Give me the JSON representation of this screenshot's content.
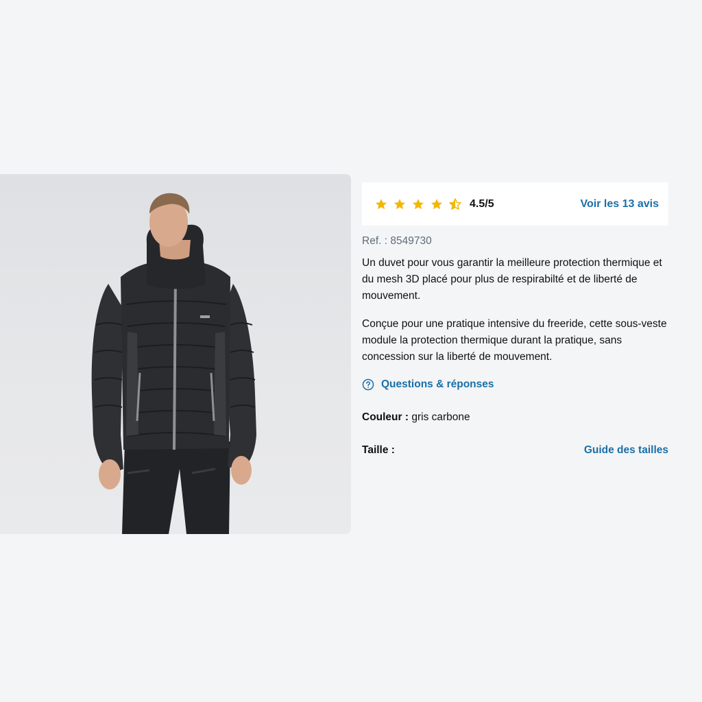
{
  "product": {
    "image_alt": "man wearing a grey down jacket",
    "rating": {
      "stars_filled": 4.5,
      "stars_total": 5,
      "value_text": "4.5/5",
      "reviews_link": "Voir les 13 avis",
      "star_color": "#f2b705"
    },
    "ref": "Ref. : 8549730",
    "description": [
      "Un duvet pour vous garantir la meilleure protection thermique et du mesh 3D placé pour plus de respirabilté et de liberté de mouvement.",
      "Conçue pour une pratique intensive du freeride, cette sous-veste module la protection thermique durant la pratique, sans concession sur la liberté de mouvement."
    ],
    "qa_link": "Questions & réponses",
    "color": {
      "label": "Couleur :",
      "value": "gris carbone"
    },
    "size": {
      "label": "Taille :",
      "guide_link": "Guide des tailles"
    },
    "jacket_brand_tag": "MAXXX",
    "colors": {
      "link": "#1a6fa6",
      "background": "#f4f5f7",
      "jacket": "#2b2c2f"
    }
  }
}
